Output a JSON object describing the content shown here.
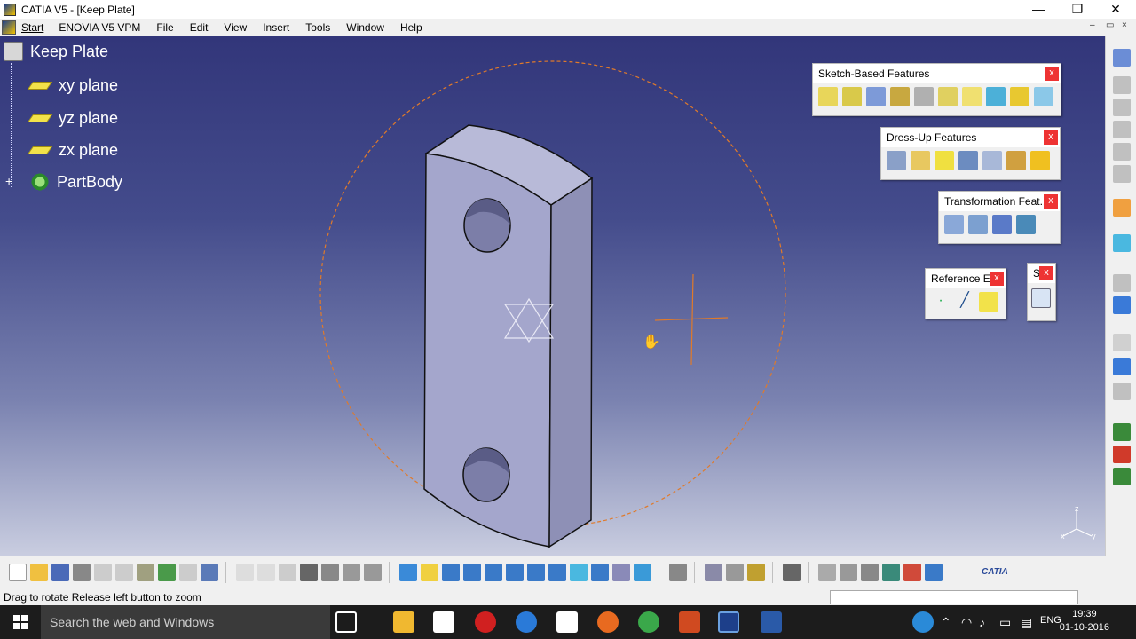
{
  "window": {
    "title": "CATIA V5 - [Keep Plate]",
    "minimize": "—",
    "restore": "❐",
    "close": "✕"
  },
  "menu": {
    "items": [
      "Start",
      "ENOVIA V5 VPM",
      "File",
      "Edit",
      "View",
      "Insert",
      "Tools",
      "Window",
      "Help"
    ],
    "mdi_min": "–",
    "mdi_restore": "▭",
    "mdi_close": "×"
  },
  "tree": {
    "root": "Keep Plate",
    "planes": [
      "xy plane",
      "yz plane",
      "zx plane"
    ],
    "body": "PartBody",
    "expand_symbol": "+"
  },
  "toolbars": {
    "sketch_based": {
      "title": "Sketch-Based Features",
      "close": "x"
    },
    "dress_up": {
      "title": "Dress-Up Features",
      "close": "x"
    },
    "transformation": {
      "title": "Transformation Feat...",
      "close": "x"
    },
    "reference": {
      "title": "Reference E...",
      "close": "x"
    },
    "sketcher": {
      "title": "S",
      "close": "x"
    }
  },
  "compass_labels": {
    "x": "x",
    "y": "y",
    "z": "z"
  },
  "status": {
    "message": "Drag to rotate  Release left button to zoom"
  },
  "taskbar": {
    "search_placeholder": "Search the web and Windows",
    "language": "ENG",
    "time": "19:39",
    "date": "01-10-2016"
  },
  "brand": {
    "catia_label": "CATIA"
  },
  "colors": {
    "viewport_top": "#32367a",
    "viewport_bottom": "#c9cde0",
    "part_face": "#a4a6cc",
    "compass_circle": "#e07a2a",
    "plane_icon": "#f2e24a"
  }
}
